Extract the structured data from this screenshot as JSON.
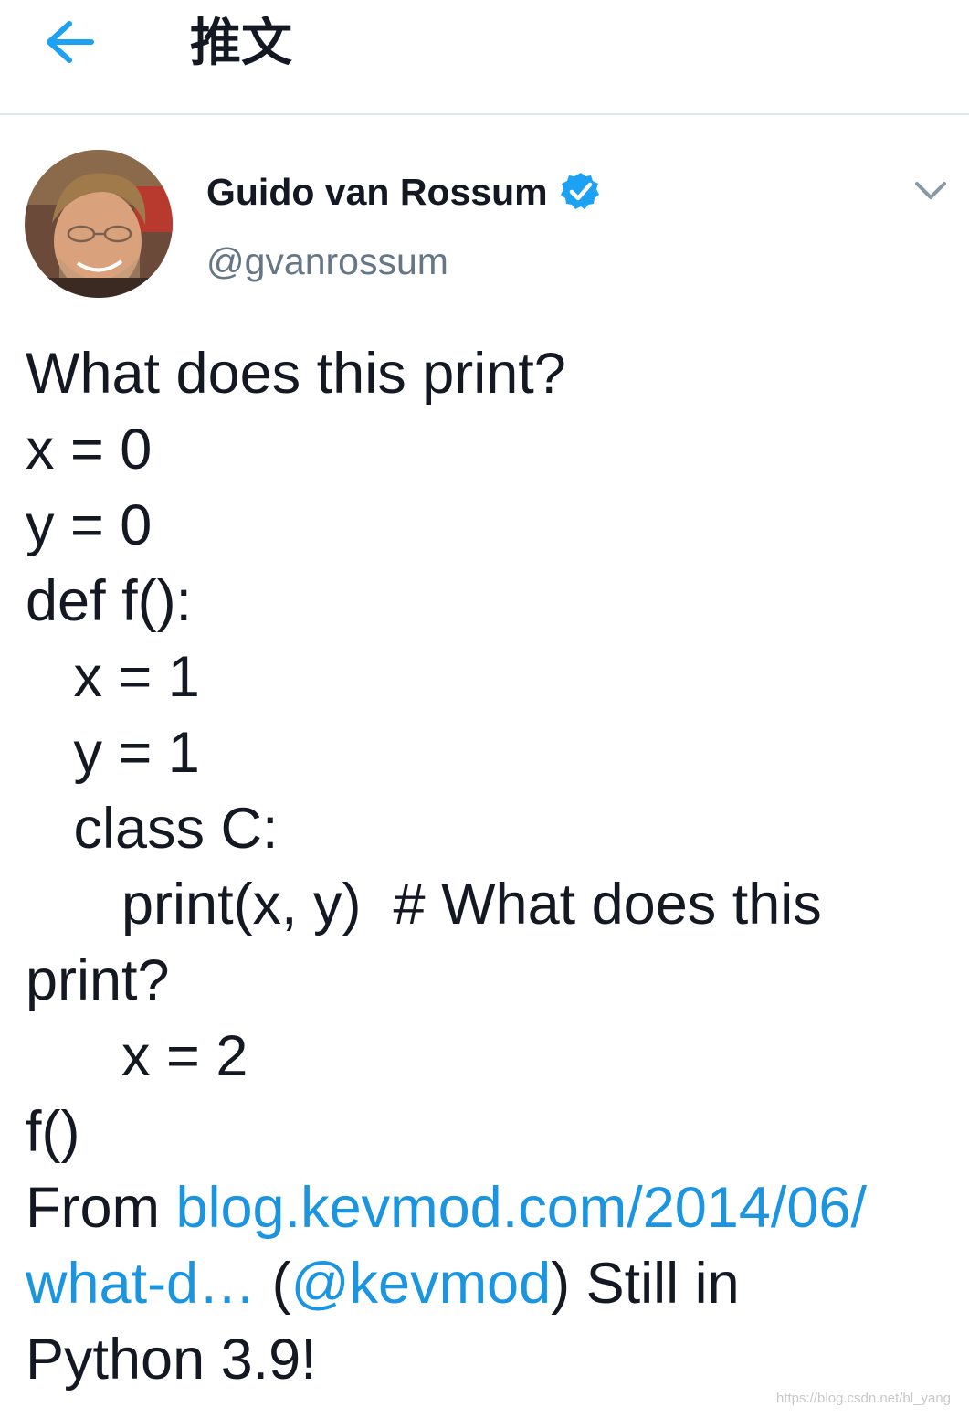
{
  "header": {
    "title": "推文"
  },
  "tweet": {
    "author_name": "Guido van Rossum",
    "author_handle": "@gvanrossum",
    "lines": [
      "What does this print?",
      "x = 0",
      "y = 0",
      "def f():",
      "   x = 1",
      "   y = 1",
      "   class C:",
      "      print(x, y)  # What does this",
      "print?",
      "      x = 2",
      "f()"
    ],
    "footer": {
      "from_prefix": "From ",
      "link_url_part1": "blog.kevmod.com/2014/06/",
      "link_url_part2": "what-d…",
      "paren_open": " (",
      "mention": "@kevmod",
      "paren_close_suffix": ") Still in",
      "last_line": "Python 3.9!"
    }
  },
  "watermark": "https://blog.csdn.net/bl_yang",
  "colors": {
    "accent": "#1b95e0",
    "secondary_text": "#657786",
    "divider": "#e1e8ed",
    "verified": "#1da1f2"
  },
  "icons": {
    "back": "arrow-left-icon",
    "verified": "verified-badge-icon",
    "menu": "chevron-down-icon"
  }
}
